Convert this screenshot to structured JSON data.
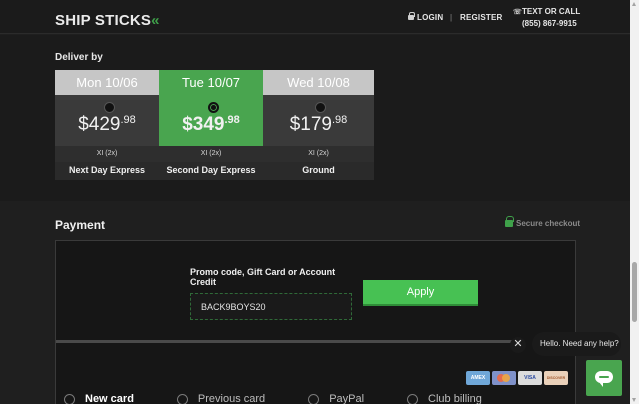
{
  "header": {
    "logo_text": "SHIP STICKS",
    "login": "LOGIN",
    "separator": "|",
    "register": "REGISTER",
    "contact_label": "TEXT OR CALL",
    "contact_number": "(855) 867-9915"
  },
  "delivery": {
    "label": "Deliver by",
    "options": [
      {
        "day": "Mon 10/06",
        "price": "$429",
        "cents": ".98",
        "sub": "XI (2x)",
        "name": "Next Day Express",
        "selected": false
      },
      {
        "day": "Tue 10/07",
        "price": "$349",
        "cents": ".98",
        "sub": "XI (2x)",
        "name": "Second Day Express",
        "selected": true
      },
      {
        "day": "Wed 10/08",
        "price": "$179",
        "cents": ".98",
        "sub": "XI (2x)",
        "name": "Ground",
        "selected": false
      }
    ]
  },
  "payment": {
    "title": "Payment",
    "secure_label": "Secure checkout",
    "promo_label": "Promo code, Gift Card or Account Credit",
    "promo_value": "BACK9BOYS20",
    "apply_label": "Apply",
    "cards": [
      "AMEX",
      "MC",
      "VISA",
      "DISCOVER"
    ],
    "methods": [
      {
        "label": "New card",
        "active": true
      },
      {
        "label": "Previous card",
        "active": false
      },
      {
        "label": "PayPal",
        "active": false
      },
      {
        "label": "Club billing",
        "active": false
      }
    ]
  },
  "chat": {
    "close": "✕",
    "message": "Hello. Need any help?"
  },
  "colors": {
    "accent_green": "#49a54f",
    "apply_green": "#47c153",
    "background": "#1b1b1b"
  }
}
